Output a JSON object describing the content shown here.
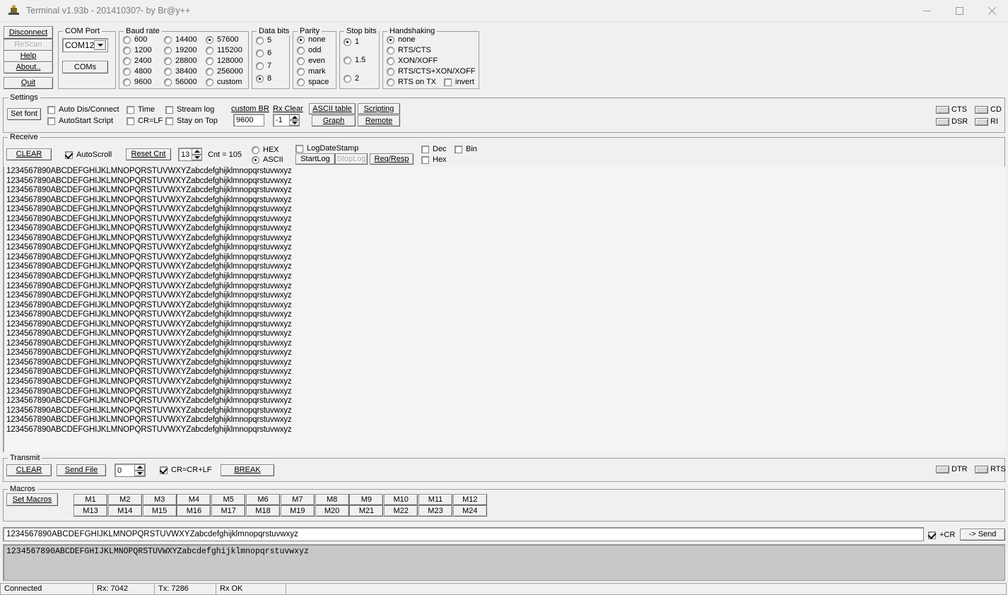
{
  "window": {
    "title": "Terminal v1.93b - 20141030?- by Br@y++",
    "icon": "terminal-app-icon",
    "minimize_label": "minimize-icon",
    "maximize_label": "maximize-icon",
    "close_label": "close-icon"
  },
  "left_buttons": [
    {
      "label": "Disconnect",
      "name": "disconnect-button",
      "disabled": false
    },
    {
      "label": "ReScan",
      "name": "rescan-button",
      "disabled": true
    },
    {
      "label": "Help",
      "name": "help-button",
      "disabled": false
    },
    {
      "label": "About..",
      "name": "about-button",
      "disabled": false
    },
    {
      "label": "Quit",
      "name": "quit-button",
      "disabled": false
    }
  ],
  "com_port": {
    "legend": "COM Port",
    "selected": "COM12",
    "coms_button": "COMs"
  },
  "baud_rate": {
    "legend": "Baud rate",
    "col1": [
      "600",
      "1200",
      "2400",
      "4800",
      "9600"
    ],
    "col2": [
      "14400",
      "19200",
      "28800",
      "38400",
      "56000"
    ],
    "col3": [
      "57600",
      "115200",
      "128000",
      "256000",
      "custom"
    ],
    "selected": "57600"
  },
  "data_bits": {
    "legend": "Data bits",
    "options": [
      "5",
      "6",
      "7",
      "8"
    ],
    "selected": "8"
  },
  "parity": {
    "legend": "Parity",
    "options": [
      "none",
      "odd",
      "even",
      "mark",
      "space"
    ],
    "selected": "none"
  },
  "stop_bits": {
    "legend": "Stop bits",
    "options": [
      "1",
      "1.5",
      "2"
    ],
    "selected": "1"
  },
  "handshaking": {
    "legend": "Handshaking",
    "options": [
      "none",
      "RTS/CTS",
      "XON/XOFF",
      "RTS/CTS+XON/XOFF",
      "RTS on TX"
    ],
    "selected": "none",
    "invert_label": "invert",
    "invert_checked": false
  },
  "settings": {
    "legend": "Settings",
    "set_font_button": "Set font",
    "checkboxes": [
      {
        "label": "Auto Dis/Connect",
        "checked": false,
        "name": "auto-dis-connect-checkbox"
      },
      {
        "label": "AutoStart Script",
        "checked": false,
        "name": "autostart-script-checkbox"
      },
      {
        "label": "Time",
        "checked": false,
        "name": "time-checkbox"
      },
      {
        "label": "CR=LF",
        "checked": false,
        "name": "cr-equals-lf-checkbox"
      },
      {
        "label": "Stream log",
        "checked": false,
        "name": "stream-log-checkbox"
      },
      {
        "label": "Stay on Top",
        "checked": false,
        "name": "stay-on-top-checkbox"
      }
    ],
    "custom_br_label": "custom BR",
    "custom_br_value": "9600",
    "rx_clear_label": "Rx Clear",
    "rx_clear_value": "-1",
    "ascii_table_button": "ASCII table",
    "scripting_button": "Scripting",
    "graph_button": "Graph",
    "remote_button": "Remote"
  },
  "modem_lamps": [
    {
      "label": "CTS",
      "name": "cts-lamp"
    },
    {
      "label": "CD",
      "name": "cd-lamp"
    },
    {
      "label": "DSR",
      "name": "dsr-lamp"
    },
    {
      "label": "RI",
      "name": "ri-lamp"
    }
  ],
  "receive": {
    "legend": "Receive",
    "clear_button": "CLEAR",
    "autoscroll_label": "AutoScroll",
    "autoscroll_checked": true,
    "reset_cnt_button": "Reset Cnt",
    "counter_value": "13",
    "cnt_label": "Cnt = 105",
    "hex_label": "HEX",
    "ascii_label": "ASCII",
    "mode_selected": "ASCII",
    "log_date_stamp_label": "LogDateStamp",
    "log_date_stamp_checked": false,
    "start_log_button": "StartLog",
    "stop_log_button": "StopLog",
    "stop_log_disabled": true,
    "req_resp_button": "Req/Resp",
    "dec_label": "Dec",
    "dec_checked": false,
    "hex_cb_label": "Hex",
    "hex_cb_checked": false,
    "bin_label": "Bin",
    "bin_checked": false,
    "line_text": "1234567890ABCDEFGHIJKLMNOPQRSTUVWXYZabcdefghijklmnopqrstuvwxyz",
    "line_count": 28
  },
  "transmit": {
    "legend": "Transmit",
    "clear_button": "CLEAR",
    "send_file_button": "Send File",
    "delay_value": "0",
    "cr_lf_label": "CR=CR+LF",
    "cr_lf_checked": true,
    "break_button": "BREAK"
  },
  "flow_lamps": [
    {
      "label": "DTR",
      "name": "dtr-lamp"
    },
    {
      "label": "RTS",
      "name": "rts-lamp"
    }
  ],
  "macros": {
    "legend": "Macros",
    "set_macros_button": "Set Macros",
    "row1": [
      "M1",
      "M2",
      "M3",
      "M4",
      "M5",
      "M6",
      "M7",
      "M8",
      "M9",
      "M10",
      "M11",
      "M12"
    ],
    "row2": [
      "M13",
      "M14",
      "M15",
      "M16",
      "M17",
      "M18",
      "M19",
      "M20",
      "M21",
      "M22",
      "M23",
      "M24"
    ]
  },
  "send_bar": {
    "input_value": "1234567890ABCDEFGHIJKLMNOPQRSTUVWXYZabcdefghijklmnopqrstuvwxyz",
    "cr_label": "+CR",
    "cr_checked": true,
    "send_button": "-> Send"
  },
  "echo": {
    "text": "1234567890ABCDEFGHIJKLMNOPQRSTUVWXYZabcdefghijklmnopqrstuvwxyz"
  },
  "status_bar": {
    "connection": "Connected",
    "rx": "Rx: 7042",
    "tx": "Tx: 7286",
    "state": "Rx OK",
    "extra": ""
  },
  "colors": {
    "face": "#f0f0f0",
    "receive_bg": "#f4f4f4",
    "echo_bg": "#c8c8c8",
    "title_text": "#7c7c7c",
    "border": "#a0a0a0"
  }
}
